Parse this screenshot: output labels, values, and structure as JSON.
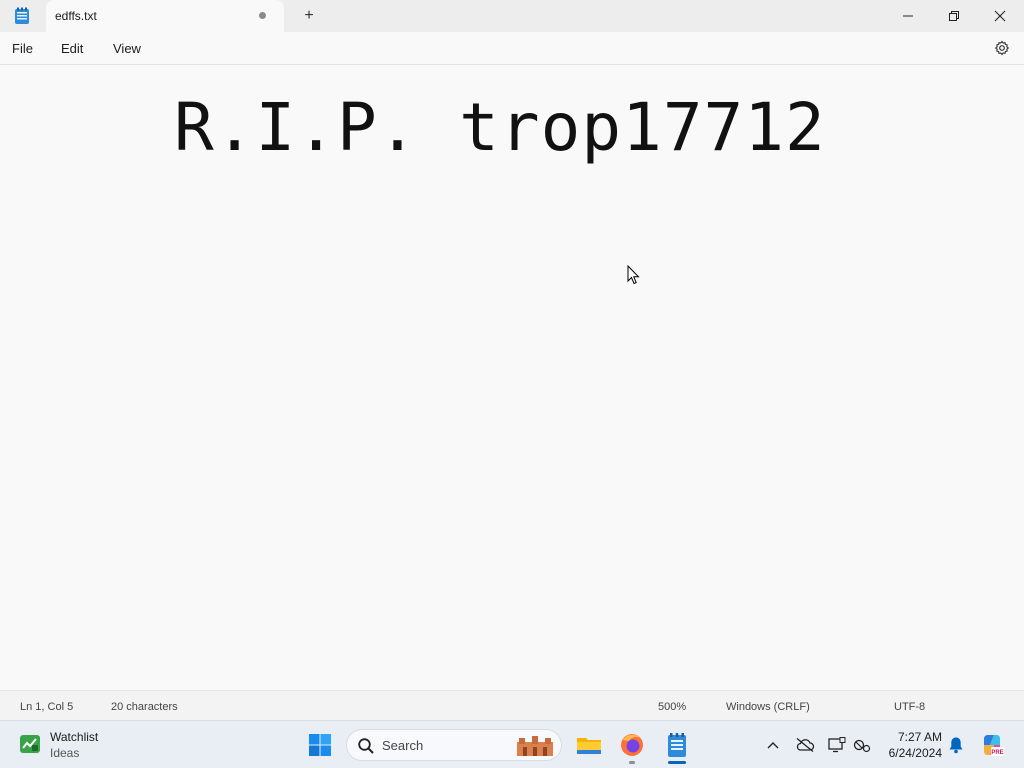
{
  "window": {
    "tab_title": "edffs.txt",
    "new_tab_symbol": "+"
  },
  "menu": {
    "file": "File",
    "edit": "Edit",
    "view": "View"
  },
  "editor": {
    "content": "R.I.P. trop17712"
  },
  "status": {
    "position": "Ln 1, Col 5",
    "characters": "20 characters",
    "zoom": "500%",
    "line_ending": "Windows (CRLF)",
    "encoding": "UTF-8"
  },
  "taskbar": {
    "widget_title": "Watchlist",
    "widget_subtitle": "Ideas",
    "search_placeholder": "Search",
    "time": "7:27 AM",
    "date": "6/24/2024"
  },
  "icons": {
    "app": "notepad-icon",
    "minimize": "minimize-icon",
    "restore": "restore-icon",
    "close": "close-icon",
    "settings": "gear-icon",
    "start": "windows-start-icon",
    "search": "search-icon",
    "explorer": "folder-icon",
    "firefox": "firefox-icon",
    "notepad": "notepad-icon",
    "tray": [
      "chevron-up-icon",
      "cloud-off-icon",
      "display-icon",
      "network-icon",
      "bell-icon",
      "copilot-icon"
    ]
  },
  "colors": {
    "accent": "#0067c0",
    "notepad_blue": "#1e88e5",
    "background": "#f9f9f9",
    "taskbar": "#e9eef5"
  }
}
